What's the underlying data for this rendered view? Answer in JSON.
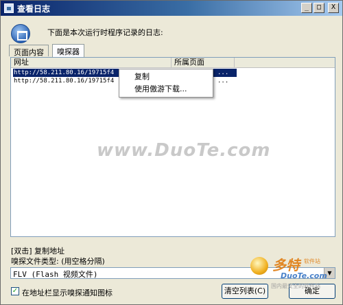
{
  "window": {
    "title": "查看日志",
    "minimize_glyph": "_",
    "maximize_glyph": "□",
    "close_glyph": "X"
  },
  "intro_text": "下面是本次运行时程序记录的日志:",
  "tabs": [
    {
      "label": "页面内容",
      "active": false
    },
    {
      "label": "嗅探器",
      "active": true
    }
  ],
  "list": {
    "columns": [
      "网址",
      "所属页面"
    ],
    "rows": [
      {
        "url": "http://58.211.80.16/19715f4",
        "page": "...",
        "selected": true
      },
      {
        "url": "http://58.211.80.16/19715f4",
        "page": "...",
        "selected": false
      }
    ]
  },
  "context_menu": {
    "items": [
      "复制",
      "使用傲游下载..."
    ]
  },
  "watermark": "www.DuoTe.com",
  "hint": "[双击] 复制地址",
  "type_label": "嗅探文件类型: (用空格分隔)",
  "file_type_value": "FLV (Flash 视频文件)",
  "select_arrow": "▼",
  "checkbox": {
    "checked": true,
    "glyph": "✓",
    "label": "在地址栏显示嗅探通知图标"
  },
  "buttons": {
    "clear": "清空列表(C)",
    "ok": "确定"
  },
  "logo": {
    "text": "多特",
    "sub": "软件站",
    "url": "DuoTe.com",
    "tagline": "国内最安全的软件站"
  },
  "colors": {
    "title_bar": "#0a246a",
    "selection": "#0a246a",
    "window_bg": "#ece9d8"
  }
}
